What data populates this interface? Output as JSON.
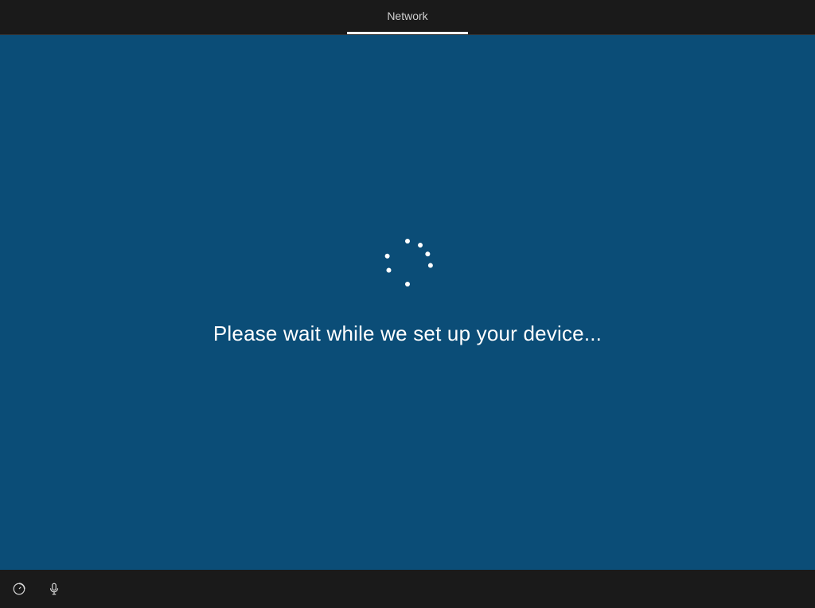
{
  "header": {
    "active_tab_label": "Network"
  },
  "main": {
    "status_message": "Please wait while we set up your device...",
    "spinner_icon": "loading-spinner",
    "background_color": "#0b4d77"
  },
  "footer": {
    "icons": [
      {
        "name": "ease-of-access-icon"
      },
      {
        "name": "microphone-icon"
      }
    ]
  }
}
